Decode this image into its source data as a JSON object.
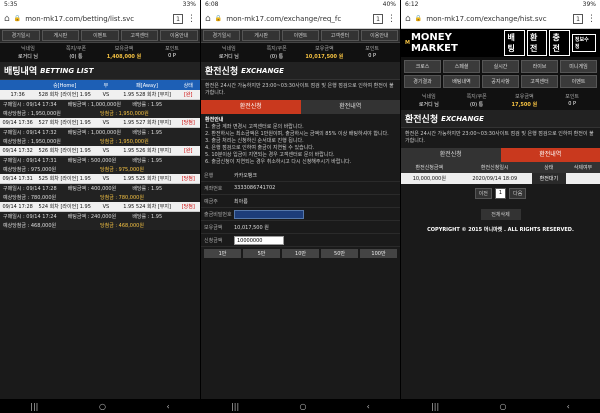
{
  "panels": {
    "p1": {
      "status": {
        "time": "5:35",
        "right": "33%"
      },
      "url": "mon-mk17.com/betting/list.svc",
      "nav": [
        "경기일시",
        "게시판",
        "이벤트",
        "고객센터",
        "이용안내"
      ],
      "user_heads": [
        "닉네임",
        "쪽지/쿠폰",
        "보유금액",
        "포인트"
      ],
      "user_vals": [
        "로거디 님",
        "(0) 통",
        "1,408,000 원",
        "0 P"
      ],
      "title": "배팅내역",
      "title_sub": "BETTING LIST",
      "bet_headers": [
        "승[Home]",
        "무",
        "패[Away]",
        "상태"
      ],
      "bets": [
        {
          "date": "17:36",
          "home": "528 회차 [라이언]",
          "odd1": "1.95",
          "vs": "VS",
          "odd2": "1.95",
          "away": "528 회차 [무지]",
          "tag": "[완]",
          "meta": [
            "구매일시 : 09/14 17:34",
            "배팅금액 : 1,000,000원",
            "배당률 : 1.95"
          ],
          "meta2": [
            "예상당첨금 : 1,950,000원",
            "당첨금 : 1,950,000원"
          ]
        },
        {
          "date": "09/14 17:36",
          "home": "527 회차 [라이언]",
          "odd1": "1.95",
          "vs": "VS",
          "odd2": "1.95",
          "away": "527 회차 [무지]",
          "tag": "[당첨]",
          "meta": [
            "구매일시 : 09/14 17:32",
            "배팅금액 : 1,000,000원",
            "배당률 : 1.95"
          ],
          "meta2": [
            "예상당첨금 : 1,950,000원",
            "당첨금 : 1,950,000원"
          ]
        },
        {
          "date": "09/14 17:32",
          "home": "526 회차 [라이언]",
          "odd1": "1.95",
          "vs": "VS",
          "odd2": "1.95",
          "away": "526 회차 [무지]",
          "tag": "[완]",
          "meta": [
            "구매일시 : 09/14 17:31",
            "배팅금액 : 500,000원",
            "배당률 : 1.95"
          ],
          "meta2": [
            "예상당첨금 : 975,000원",
            "당첨금 : 975,000원"
          ]
        },
        {
          "date": "09/14 17:31",
          "home": "525 회차 [라이언]",
          "odd1": "1.95",
          "vs": "VS",
          "odd2": "1.95",
          "away": "525 회차 [무지]",
          "tag": "[당첨]",
          "meta": [
            "구매일시 : 09/14 17:28",
            "배팅금액 : 400,000원",
            "배당률 : 1.95"
          ],
          "meta2": [
            "예상당첨금 : 780,000원",
            "당첨금 : 780,000원"
          ]
        },
        {
          "date": "09/14 17:28",
          "home": "524 회차 [라이언]",
          "odd1": "1.95",
          "vs": "VS",
          "odd2": "1.95",
          "away": "524 회차 [무지]",
          "tag": "[당첨]",
          "meta": [
            "구매일시 : 09/14 17:24",
            "배팅금액 : 240,000원",
            "배당률 : 1.95"
          ],
          "meta2": [
            "예상당첨금 : 468,000원",
            "당첨금 : 468,000원"
          ]
        }
      ]
    },
    "p2": {
      "status": {
        "time": "6:08",
        "right": "40%"
      },
      "url": "mon-mk17.com/exchange/req_fc",
      "nav": [
        "경기일시",
        "게시판",
        "이벤트",
        "고객센터",
        "이용안내"
      ],
      "user_heads": [
        "닉네임",
        "쪽지/쿠폰",
        "보유금액",
        "포인트"
      ],
      "user_vals": [
        "로거디 님",
        "(0) 통",
        "10,017,500 원",
        "0 P"
      ],
      "title": "환전신청",
      "title_sub": "EXCHANGE",
      "notice": "환전은 24시간 가능하지만 23:00~03:30사이트 점검 및 은행 점검으로 인하여 환전이 불가합니다.",
      "tabs": [
        "환전신청",
        "환전내역"
      ],
      "guide_title": "환전안내",
      "guide": [
        "1. 출금 계좌 변경시 고객센터로 문의 바랍니다.",
        "2. 환전하시는 최소금액은 1만원이며, 출금하시는 금액의 85% 이상 배팅하셔야 합니다.",
        "3. 출금 처리는 신청하신 순서대로 진행 됩니다.",
        "4. 은행 점검으로 인하여 출금이 지연될 수 있습니다.",
        "5. 10분이상 입금이 지연되는 경우 고객센터로 문의 바랍니다.",
        "6. 출금신청이 지연되는 경우 취소하시고 다시 신청해주시기 바랍니다."
      ],
      "form": {
        "bank_label": "은행",
        "bank_val": "카카오뱅크",
        "acct_label": "계좌번호",
        "acct_val": "3333086741702",
        "holder_label": "예금주",
        "holder_val": "최아름",
        "pw_label": "출금비밀번호",
        "have_label": "보유금액",
        "have_val": "10,017,500 원",
        "req_label": "신청금액",
        "req_val": "10000000"
      },
      "amounts": [
        "1만",
        "5만",
        "10만",
        "50만",
        "100만"
      ]
    },
    "p3": {
      "status": {
        "time": "6:12",
        "right": "39%"
      },
      "url": "mon-mk17.com/exchange/hist.svc",
      "logo": "MONEY MARKET",
      "logo_prefix": "M",
      "head_btns": [
        "배팅",
        "환전",
        "충전",
        "정보수정"
      ],
      "nav": [
        "크로스",
        "스페셜",
        "실시간",
        "라이브",
        "미니게임",
        "경기결과",
        "배팅내역",
        "공지사항",
        "고객센터",
        "이벤트"
      ],
      "user_heads": [
        "닉네임",
        "쪽지/쿠폰",
        "보유금액",
        "포인트"
      ],
      "user_vals": [
        "로거디 님",
        "(0) 통",
        "17,500 원",
        "0 P"
      ],
      "title": "환전신청",
      "title_sub": "EXCHANGE",
      "notice": "환전은 24시간 가능하지만 23:00~03:30사이트 점검 및 은행 점검으로 인하여 환전이 불가합니다.",
      "tabs": [
        "환전신청",
        "환전내역"
      ],
      "hist_headers": [
        "환전신청금액",
        "환전신청일시",
        "상태",
        "삭제여부"
      ],
      "hist_rows": [
        [
          "10,000,000원",
          "2020/09/14 18:09",
          "환전대기",
          ""
        ]
      ],
      "pager": [
        "이전",
        "1",
        "다음"
      ],
      "delete_btn": "전체삭제",
      "copyright": "COPYRIGHT © 2015 머니마켓 . ALL RIGHTS RESERVED."
    }
  },
  "colors": {
    "accent": "#1d5fb5",
    "tab_active": "#c9391e",
    "gold": "#f5c242"
  }
}
